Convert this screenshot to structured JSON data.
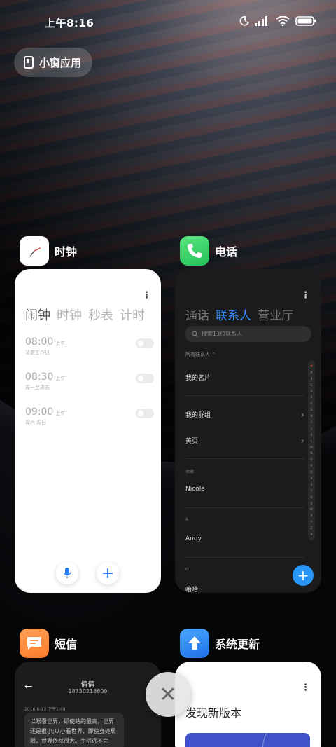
{
  "status_bar": {
    "time": "上午8:16",
    "icons": [
      "moon-icon",
      "signal-icon",
      "wifi-icon",
      "battery-icon"
    ]
  },
  "small_window": {
    "label": "小窗应用",
    "icon": "small-window-icon"
  },
  "cards": {
    "clock": {
      "name": "时钟",
      "tabs": [
        "闹钟",
        "时钟",
        "秒表",
        "计时"
      ],
      "active_tab": "闹钟",
      "alarms": [
        {
          "time": "08:00",
          "ampm": "上午",
          "repeat": "法定工作日"
        },
        {
          "time": "08:30",
          "ampm": "上午",
          "repeat": "周一至周五"
        },
        {
          "time": "09:00",
          "ampm": "上午",
          "repeat": "周六 周日"
        }
      ],
      "icons": [
        "mic-icon",
        "plus-icon"
      ]
    },
    "phone": {
      "name": "电话",
      "tabs": [
        "通话",
        "联系人",
        "营业厅"
      ],
      "active_tab": "联系人",
      "search_placeholder": "搜索13位联系人",
      "all_contacts": "所有联系人",
      "my_card": "我的名片",
      "my_groups": "我的群组",
      "yellow_pages": "黄页",
      "favorites_label": "收藏",
      "favorite_contact": "Nicole",
      "section_a": "A",
      "contact_a": "Andy",
      "section_h": "H",
      "contact_h": "哈哈",
      "alphabet": [
        "♥",
        "A",
        "B",
        "C",
        "D",
        "E",
        "F",
        "G",
        "H",
        "I",
        "J",
        "K",
        "L",
        "M",
        "N",
        "O",
        "P",
        "Q",
        "R",
        "S",
        "T",
        "U",
        "V",
        "W",
        "X",
        "Y",
        "Z",
        "#"
      ]
    },
    "sms": {
      "name": "短信",
      "title": "倩倩",
      "number": "18730218809",
      "date": "2016-6-13 下午1:49",
      "message": "以眼看世界，即使站的最高，世界还是很小;以心看世界，即使身处局限，世界依然很大。生活远不完"
    },
    "update": {
      "name": "系统更新",
      "title": "发现新版本"
    }
  },
  "colors": {
    "accent_blue": "#2f8cff",
    "fab_blue": "#2796f7",
    "phone_green": "#3ed26a",
    "sms_orange": "#ff8a3a",
    "update_blue": "#2f8cff"
  }
}
